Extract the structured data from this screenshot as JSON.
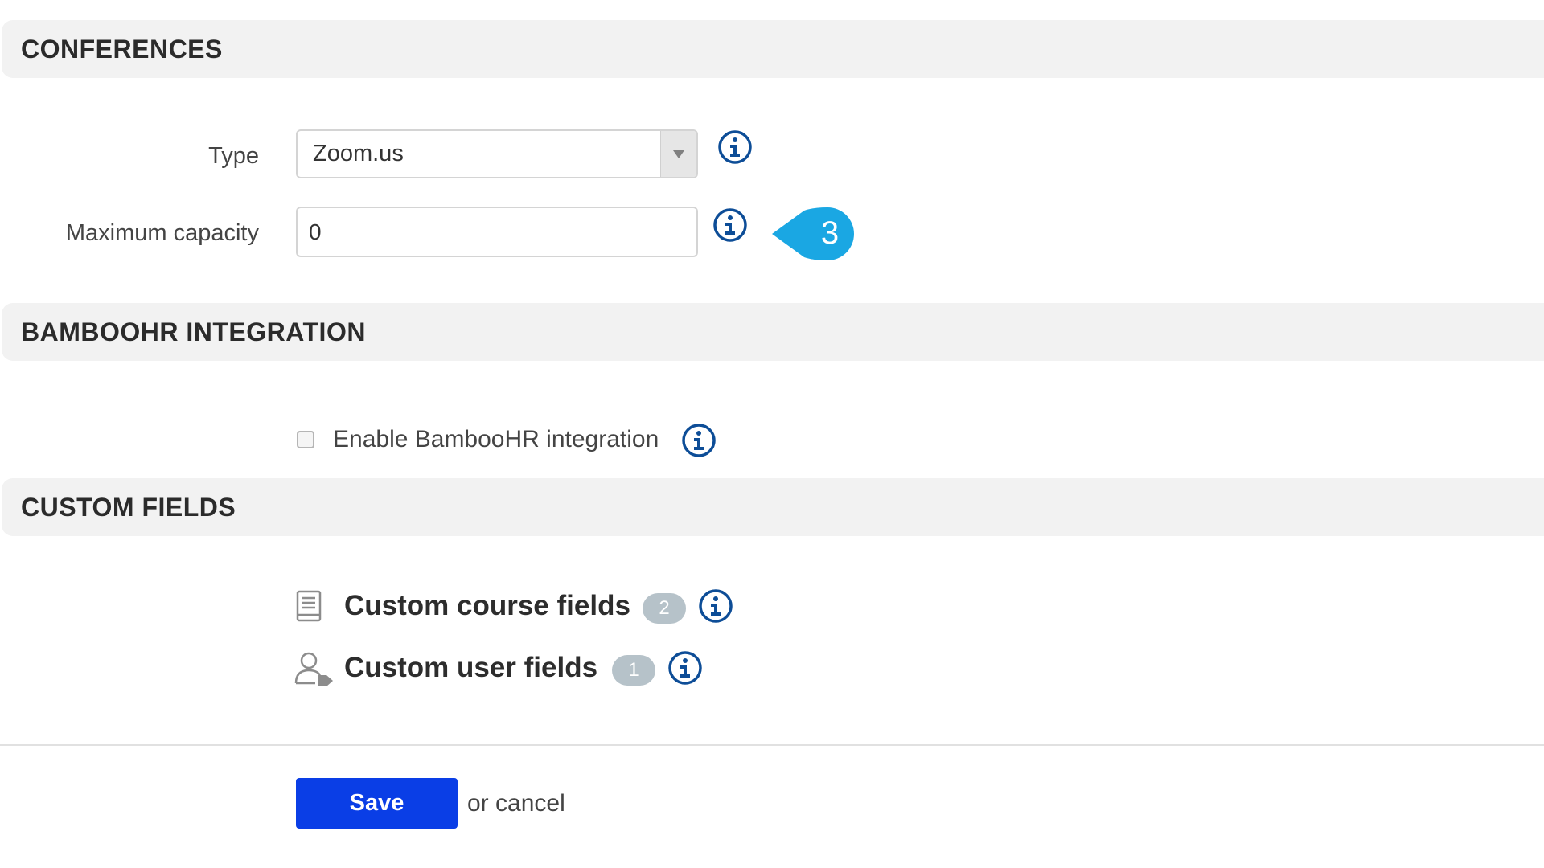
{
  "sections": {
    "conferences": "CONFERENCES",
    "bamboohr": "BAMBOOHR INTEGRATION",
    "custom_fields": "CUSTOM FIELDS"
  },
  "conferences": {
    "type_label": "Type",
    "type_value": "Zoom.us",
    "capacity_label": "Maximum capacity",
    "capacity_value": "0"
  },
  "callout": {
    "number": "3",
    "color": "#1aa7e3"
  },
  "bamboohr": {
    "checkbox_label": "Enable BambooHR integration",
    "checked": false
  },
  "custom_fields": {
    "course": {
      "label": "Custom course fields",
      "count": "2",
      "icon": "document-icon"
    },
    "user": {
      "label": "Custom user fields",
      "count": "1",
      "icon": "user-tag-icon"
    }
  },
  "actions": {
    "save_label": "Save",
    "or_text": "or ",
    "cancel_label": "cancel"
  },
  "colors": {
    "info_icon": "#0d4d97",
    "save_button": "#0a3ee6",
    "badge": "#b6c2c9"
  }
}
